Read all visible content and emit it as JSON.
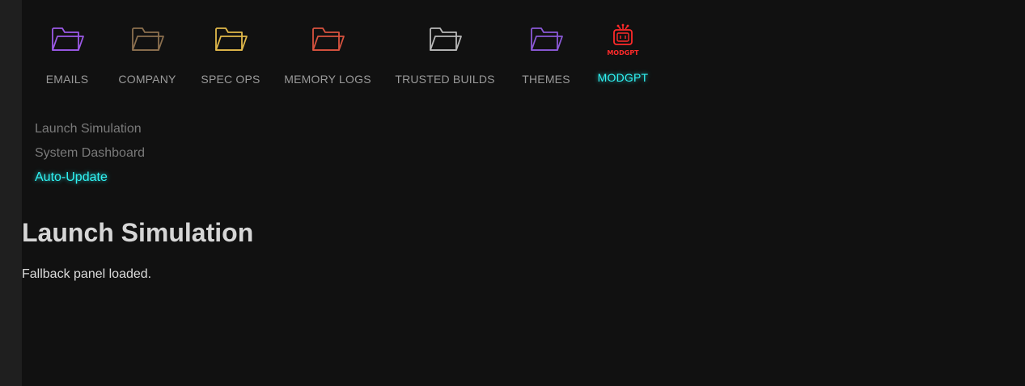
{
  "folders": [
    {
      "label": "EMAILS",
      "icon": "folder-icon",
      "color": "#9b59e6"
    },
    {
      "label": "COMPANY",
      "icon": "folder-icon",
      "color": "#8b6f4e"
    },
    {
      "label": "SPEC OPS",
      "icon": "folder-icon",
      "color": "#e0b84a"
    },
    {
      "label": "MEMORY LOGS",
      "icon": "folder-icon",
      "color": "#d9533f"
    },
    {
      "label": "TRUSTED BUILDS",
      "icon": "folder-icon",
      "color": "#b8b8b8"
    },
    {
      "label": "THEMES",
      "icon": "folder-icon",
      "color": "#8a58d6"
    },
    {
      "label": "MODGPT",
      "icon": "robot-tv-icon",
      "icon_text": "MODGPT",
      "color": "#ff2a2a",
      "active": true
    }
  ],
  "submenu": [
    {
      "label": "Launch Simulation"
    },
    {
      "label": "System Dashboard"
    },
    {
      "label": "Auto-Update",
      "active": true
    }
  ],
  "main": {
    "title": "Launch Simulation",
    "status": "Fallback panel loaded."
  },
  "colors": {
    "accent": "#2ff3f3",
    "background": "#111111",
    "sidebar_strip": "#1f1f1f"
  }
}
